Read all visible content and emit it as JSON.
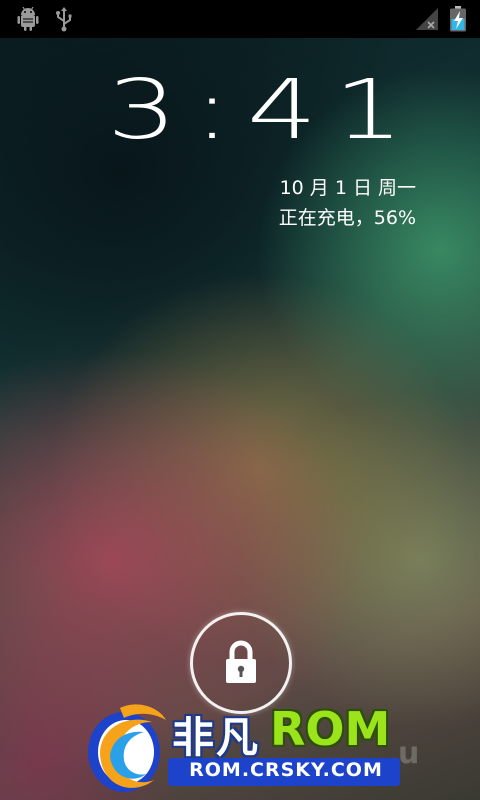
{
  "status_bar": {
    "icons": [
      "android-debug-icon",
      "usb-icon",
      "no-signal-icon",
      "battery-charging-icon"
    ],
    "battery_color": "#33b5e5"
  },
  "lockscreen": {
    "time": "3:41",
    "date": "10 月 1 日 周一",
    "charging": "正在充电，56%",
    "unlock_icon": "lock-icon",
    "battery_percent": 56
  },
  "watermark": {
    "title_cn": "非凡",
    "title_rom": "ROM",
    "url": "ROM.CRSKY.COM",
    "faint_text": "u",
    "accent_green": "#9be31a",
    "accent_blue": "#1c43c9"
  }
}
